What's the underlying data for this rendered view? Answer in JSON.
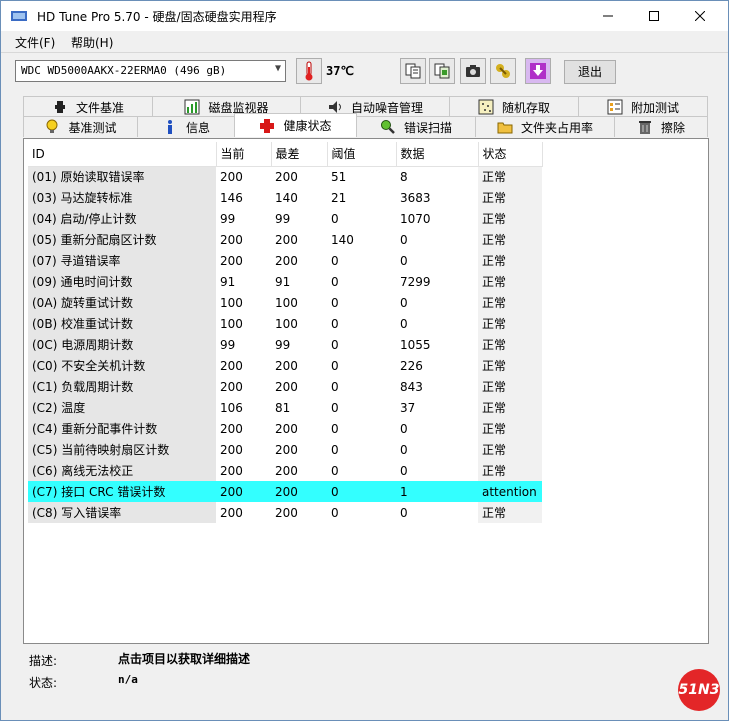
{
  "window": {
    "title": "HD Tune Pro 5.70 - 硬盘/固态硬盘实用程序"
  },
  "menu": {
    "file": "文件(F)",
    "help": "帮助(H)"
  },
  "toolbar": {
    "drive": "WDC WD5000AAKX-22ERMA0 (496 gB)",
    "temperature": "37℃",
    "exit_label": "退出"
  },
  "tabs": {
    "row1": [
      "文件基准",
      "磁盘监视器",
      "自动噪音管理",
      "随机存取",
      "附加测试"
    ],
    "row2": [
      "基准测试",
      "信息",
      "健康状态",
      "错误扫描",
      "文件夹占用率",
      "擦除"
    ]
  },
  "table": {
    "headers": [
      "ID",
      "当前",
      "最差",
      "阈值",
      "数据",
      "状态"
    ],
    "rows": [
      [
        "(01) 原始读取错误率",
        "200",
        "200",
        "51",
        "8",
        "正常"
      ],
      [
        "(03) 马达旋转标准",
        "146",
        "140",
        "21",
        "3683",
        "正常"
      ],
      [
        "(04) 启动/停止计数",
        "99",
        "99",
        "0",
        "1070",
        "正常"
      ],
      [
        "(05) 重新分配扇区计数",
        "200",
        "200",
        "140",
        "0",
        "正常"
      ],
      [
        "(07) 寻道错误率",
        "200",
        "200",
        "0",
        "0",
        "正常"
      ],
      [
        "(09) 通电时间计数",
        "91",
        "91",
        "0",
        "7299",
        "正常"
      ],
      [
        "(0A) 旋转重试计数",
        "100",
        "100",
        "0",
        "0",
        "正常"
      ],
      [
        "(0B) 校准重试计数",
        "100",
        "100",
        "0",
        "0",
        "正常"
      ],
      [
        "(0C) 电源周期计数",
        "99",
        "99",
        "0",
        "1055",
        "正常"
      ],
      [
        "(C0) 不安全关机计数",
        "200",
        "200",
        "0",
        "226",
        "正常"
      ],
      [
        "(C1) 负载周期计数",
        "200",
        "200",
        "0",
        "843",
        "正常"
      ],
      [
        "(C2) 温度",
        "106",
        "81",
        "0",
        "37",
        "正常"
      ],
      [
        "(C4) 重新分配事件计数",
        "200",
        "200",
        "0",
        "0",
        "正常"
      ],
      [
        "(C5) 当前待映射扇区计数",
        "200",
        "200",
        "0",
        "0",
        "正常"
      ],
      [
        "(C6) 离线无法校正",
        "200",
        "200",
        "0",
        "0",
        "正常"
      ],
      [
        "(C7) 接口 CRC 错误计数",
        "200",
        "200",
        "0",
        "1",
        "attention"
      ],
      [
        "(C8) 写入错误率",
        "200",
        "200",
        "0",
        "0",
        "正常"
      ]
    ],
    "highlight_color": "#33ffff"
  },
  "footer": {
    "desc_label": "描述:",
    "desc_value": "点击项目以获取详细描述",
    "status_label": "状态:",
    "status_value": "n/a"
  },
  "logo": "51N3"
}
